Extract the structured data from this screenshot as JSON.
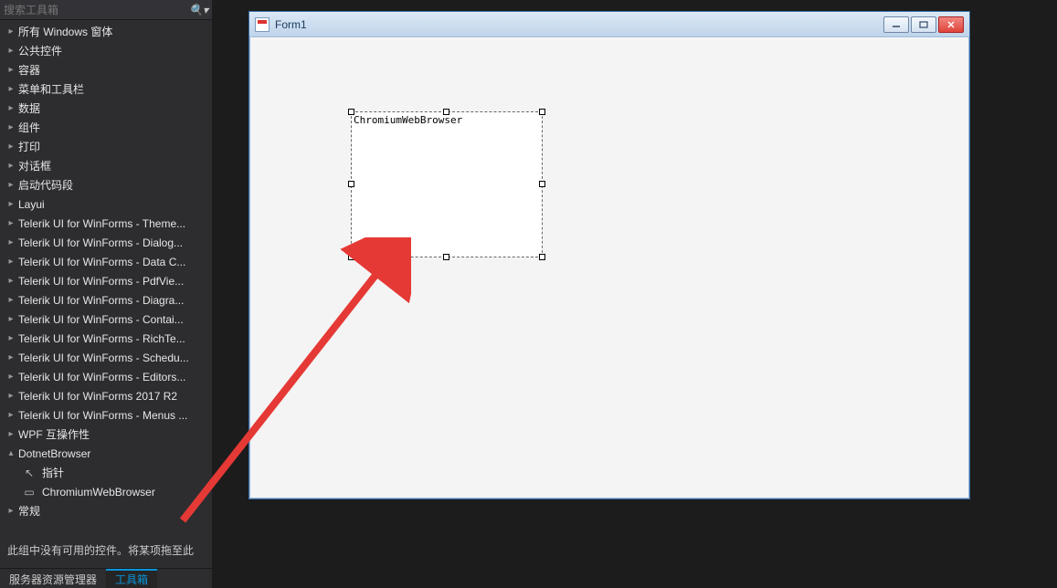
{
  "toolbox": {
    "search_placeholder": "搜索工具箱",
    "items": [
      {
        "label": "所有 Windows 窗体",
        "expanded": false
      },
      {
        "label": "公共控件",
        "expanded": false
      },
      {
        "label": "容器",
        "expanded": false
      },
      {
        "label": "菜单和工具栏",
        "expanded": false
      },
      {
        "label": "数据",
        "expanded": false
      },
      {
        "label": "组件",
        "expanded": false
      },
      {
        "label": "打印",
        "expanded": false
      },
      {
        "label": "对话框",
        "expanded": false
      },
      {
        "label": "启动代码段",
        "expanded": false
      },
      {
        "label": "Layui",
        "expanded": false
      },
      {
        "label": "Telerik UI for WinForms - Theme...",
        "expanded": false
      },
      {
        "label": "Telerik UI for WinForms - Dialog...",
        "expanded": false
      },
      {
        "label": "Telerik UI for WinForms - Data C...",
        "expanded": false
      },
      {
        "label": "Telerik UI for WinForms - PdfVie...",
        "expanded": false
      },
      {
        "label": "Telerik UI for WinForms - Diagra...",
        "expanded": false
      },
      {
        "label": "Telerik UI for WinForms - Contai...",
        "expanded": false
      },
      {
        "label": "Telerik UI for WinForms - RichTe...",
        "expanded": false
      },
      {
        "label": "Telerik UI for WinForms - Schedu...",
        "expanded": false
      },
      {
        "label": "Telerik UI for WinForms - Editors...",
        "expanded": false
      },
      {
        "label": "Telerik UI for WinForms 2017 R2",
        "expanded": false
      },
      {
        "label": "Telerik UI for WinForms - Menus ...",
        "expanded": false
      },
      {
        "label": "WPF 互操作性",
        "expanded": false
      },
      {
        "label": "DotnetBrowser",
        "expanded": true
      },
      {
        "label": "常规",
        "expanded": false
      }
    ],
    "dotnet_children": [
      {
        "icon": "pointer",
        "label": "指针"
      },
      {
        "icon": "component",
        "label": "ChromiumWebBrowser"
      }
    ],
    "empty_text": "此组中没有可用的控件。将某项拖至此"
  },
  "bottom_tabs": {
    "server_explorer": "服务器资源管理器",
    "toolbox": "工具箱"
  },
  "designer": {
    "form_title": "Form1",
    "control_label": "ChromiumWebBrowser"
  },
  "colors": {
    "accent": "#0b94d8",
    "arrow": "#e53935"
  }
}
